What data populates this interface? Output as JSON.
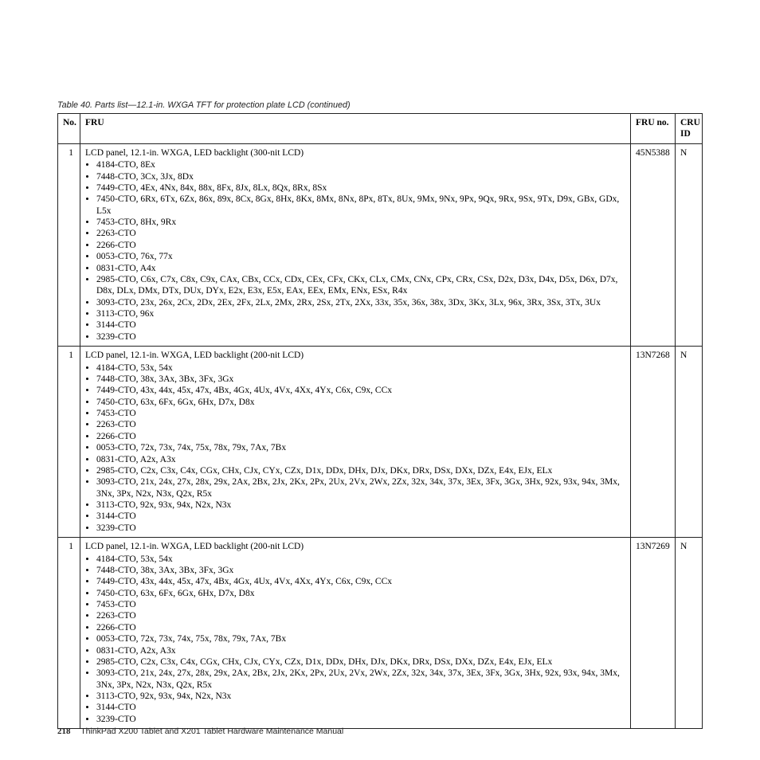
{
  "table_caption": "Table 40. Parts list—12.1-in. WXGA TFT for protection plate LCD  (continued)",
  "headers": {
    "no": "No.",
    "fru": "FRU",
    "fru_no": "FRU no.",
    "cru_id": "CRU ID"
  },
  "rows": [
    {
      "no": "1",
      "description": "LCD panel, 12.1-in. WXGA, LED backlight (300-nit LCD)",
      "bullets": [
        "4184-CTO, 8Ex",
        "7448-CTO, 3Cx, 3Jx, 8Dx",
        "7449-CTO, 4Ex, 4Nx, 84x, 88x, 8Fx, 8Jx, 8Lx, 8Qx, 8Rx, 8Sx",
        "7450-CTO, 6Rx, 6Tx, 6Zx, 86x, 89x, 8Cx, 8Gx, 8Hx, 8Kx, 8Mx, 8Nx, 8Px, 8Tx, 8Ux, 9Mx, 9Nx, 9Px, 9Qx, 9Rx, 9Sx, 9Tx, D9x, GBx, GDx, L5x",
        "7453-CTO, 8Hx, 9Rx",
        "2263-CTO",
        "2266-CTO",
        "0053-CTO, 76x, 77x",
        "0831-CTO, A4x",
        "2985-CTO, C6x, C7x, C8x, C9x, CAx, CBx, CCx, CDx, CEx, CFx, CKx, CLx, CMx, CNx, CPx, CRx, CSx, D2x, D3x, D4x, D5x, D6x, D7x, D8x, DLx, DMx, DTx, DUx, DYx, E2x, E3x, E5x, EAx, EEx, EMx, ENx, ESx, R4x",
        "3093-CTO, 23x, 26x, 2Cx, 2Dx, 2Ex, 2Fx, 2Lx, 2Mx, 2Rx, 2Sx, 2Tx, 2Xx, 33x, 35x, 36x, 38x, 3Dx, 3Kx, 3Lx, 96x, 3Rx, 3Sx, 3Tx, 3Ux",
        "3113-CTO, 96x",
        "3144-CTO",
        "3239-CTO"
      ],
      "fru_no": "45N5388",
      "cru_id": "N"
    },
    {
      "no": "1",
      "description": "LCD panel, 12.1-in. WXGA, LED backlight (200-nit LCD)",
      "bullets": [
        "4184-CTO, 53x, 54x",
        "7448-CTO, 38x, 3Ax, 3Bx, 3Fx, 3Gx",
        "7449-CTO, 43x, 44x, 45x, 47x, 4Bx, 4Gx, 4Ux, 4Vx, 4Xx, 4Yx, C6x, C9x, CCx",
        "7450-CTO, 63x, 6Fx, 6Gx, 6Hx, D7x, D8x",
        "7453-CTO",
        "2263-CTO",
        "2266-CTO",
        "0053-CTO, 72x, 73x, 74x, 75x, 78x, 79x, 7Ax, 7Bx",
        "0831-CTO, A2x, A3x",
        "2985-CTO, C2x, C3x, C4x, CGx, CHx, CJx, CYx, CZx, D1x, DDx, DHx, DJx, DKx, DRx, DSx, DXx, DZx, E4x, EJx, ELx",
        "3093-CTO, 21x, 24x, 27x, 28x, 29x, 2Ax, 2Bx, 2Jx, 2Kx, 2Px, 2Ux, 2Vx, 2Wx, 2Zx, 32x, 34x, 37x, 3Ex, 3Fx, 3Gx, 3Hx, 92x, 93x, 94x, 3Mx, 3Nx, 3Px, N2x, N3x, Q2x, R5x",
        "3113-CTO, 92x, 93x, 94x, N2x, N3x",
        "3144-CTO",
        "3239-CTO"
      ],
      "fru_no": "13N7268",
      "cru_id": "N"
    },
    {
      "no": "1",
      "description": "LCD panel, 12.1-in. WXGA, LED backlight (200-nit LCD)",
      "bullets": [
        "4184-CTO, 53x, 54x",
        "7448-CTO, 38x, 3Ax, 3Bx, 3Fx, 3Gx",
        "7449-CTO, 43x, 44x, 45x, 47x, 4Bx, 4Gx, 4Ux, 4Vx, 4Xx, 4Yx, C6x, C9x, CCx",
        "7450-CTO, 63x, 6Fx, 6Gx, 6Hx, D7x, D8x",
        "7453-CTO",
        "2263-CTO",
        "2266-CTO",
        "0053-CTO, 72x, 73x, 74x, 75x, 78x, 79x, 7Ax, 7Bx",
        "0831-CTO, A2x, A3x",
        "2985-CTO, C2x, C3x, C4x, CGx, CHx, CJx, CYx, CZx, D1x, DDx, DHx, DJx, DKx, DRx, DSx, DXx, DZx, E4x, EJx, ELx",
        "3093-CTO, 21x, 24x, 27x, 28x, 29x, 2Ax, 2Bx, 2Jx, 2Kx, 2Px, 2Ux, 2Vx, 2Wx, 2Zx, 32x, 34x, 37x, 3Ex, 3Fx, 3Gx, 3Hx, 92x, 93x, 94x, 3Mx, 3Nx, 3Px, N2x, N3x, Q2x, R5x",
        "3113-CTO, 92x, 93x, 94x, N2x, N3x",
        "3144-CTO",
        "3239-CTO"
      ],
      "fru_no": "13N7269",
      "cru_id": "N"
    }
  ],
  "footer": {
    "page_number": "218",
    "manual_title": "ThinkPad X200 Tablet and X201 Tablet Hardware Maintenance Manual"
  }
}
